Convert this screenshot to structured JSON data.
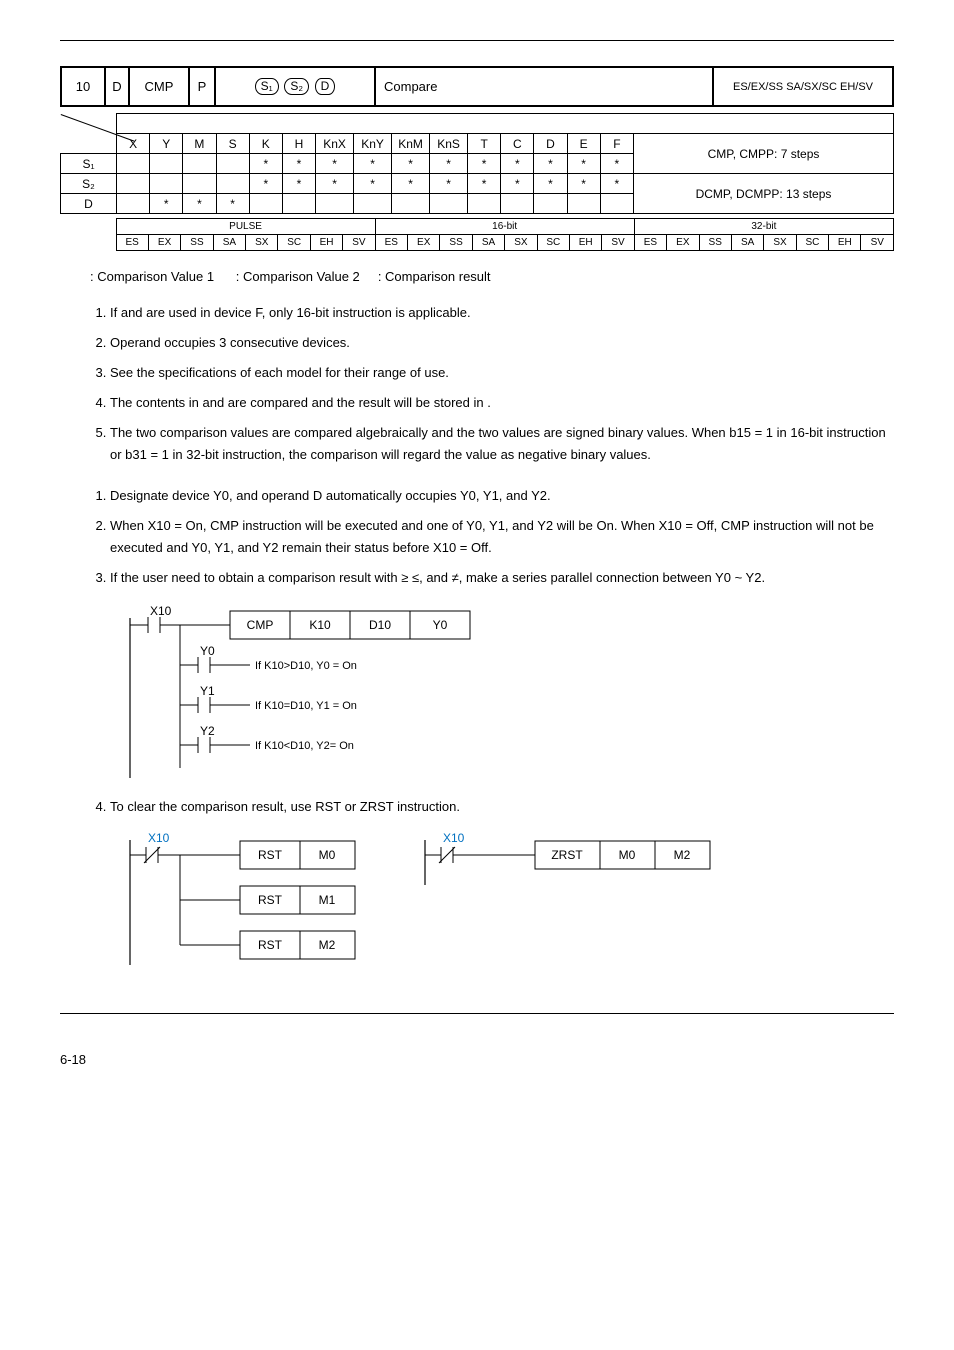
{
  "api": {
    "number": "10",
    "dflag": "D",
    "mnemonic": "CMP",
    "pflag": "P",
    "op1": "S₁",
    "op2": "S₂",
    "op3": "D",
    "function": "Compare",
    "models": "ES/EX/SS SA/SX/SC EH/SV"
  },
  "matrix": {
    "headers": [
      "X",
      "Y",
      "M",
      "S",
      "K",
      "H",
      "KnX",
      "KnY",
      "KnM",
      "KnS",
      "T",
      "C",
      "D",
      "E",
      "F"
    ],
    "notes1": "CMP, CMPP: 7 steps",
    "notes2": "DCMP, DCMPP: 13 steps",
    "rows": [
      {
        "label": "S₁",
        "cells": [
          "",
          "",
          "",
          "",
          "*",
          "*",
          "*",
          "*",
          "*",
          "*",
          "*",
          "*",
          "*",
          "*",
          "*"
        ]
      },
      {
        "label": "S₂",
        "cells": [
          "",
          "",
          "",
          "",
          "*",
          "*",
          "*",
          "*",
          "*",
          "*",
          "*",
          "*",
          "*",
          "*",
          "*"
        ]
      },
      {
        "label": "D",
        "cells": [
          "",
          "*",
          "*",
          "*",
          "",
          "",
          "",
          "",
          "",
          "",
          "",
          "",
          "",
          "",
          ""
        ]
      }
    ]
  },
  "pb": {
    "h1": "PULSE",
    "h2": "16-bit",
    "h3": "32-bit",
    "cells": [
      "ES",
      "EX",
      "SS",
      "SA",
      "SX",
      "SC",
      "EH",
      "SV",
      "ES",
      "EX",
      "SS",
      "SA",
      "SX",
      "SC",
      "EH",
      "SV",
      "ES",
      "EX",
      "SS",
      "SA",
      "SX",
      "SC",
      "EH",
      "SV"
    ]
  },
  "operands_desc": ": Comparison Value 1      : Comparison Value 2     : Comparison result",
  "explanations": [
    "If   and    are used in device F, only 16-bit instruction is applicable.",
    "Operand    occupies 3 consecutive devices.",
    "See the specifications of each model for their range of use.",
    "The contents in    and    are compared and the result will be stored in   .",
    "The two comparison values are compared algebraically and the two values are signed binary values. When b15 = 1 in 16-bit instruction or b31 = 1 in 32-bit instruction, the comparison will regard the value as negative binary values."
  ],
  "examples": [
    "Designate device Y0, and operand D automatically occupies Y0, Y1, and Y2.",
    "When X10 = On, CMP instruction will be executed and one of Y0, Y1, and Y2 will be On. When X10 = Off, CMP instruction will not be executed and Y0, Y1, and Y2 remain their status before X10 = Off.",
    "If the user need to obtain a comparison result with ≥ ≤, and ≠, make a series parallel connection between Y0 ~ Y2."
  ],
  "ladder1": {
    "contact": "X10",
    "inst": "CMP",
    "p1": "K10",
    "p2": "D10",
    "p3": "Y0",
    "y0": "Y0",
    "y0txt": "If K10>D10, Y0 = On",
    "y1": "Y1",
    "y1txt": "If K10=D10, Y1 = On",
    "y2": "Y2",
    "y2txt": "If K10<D10, Y2= On"
  },
  "example4": "To clear the comparison result, use RST or ZRST instruction.",
  "ladder2a": {
    "contact": "X10",
    "r1": {
      "inst": "RST",
      "p": "M0"
    },
    "r2": {
      "inst": "RST",
      "p": "M1"
    },
    "r3": {
      "inst": "RST",
      "p": "M2"
    }
  },
  "ladder2b": {
    "contact": "X10",
    "inst": "ZRST",
    "p1": "M0",
    "p2": "M2"
  },
  "footer": "6-18"
}
